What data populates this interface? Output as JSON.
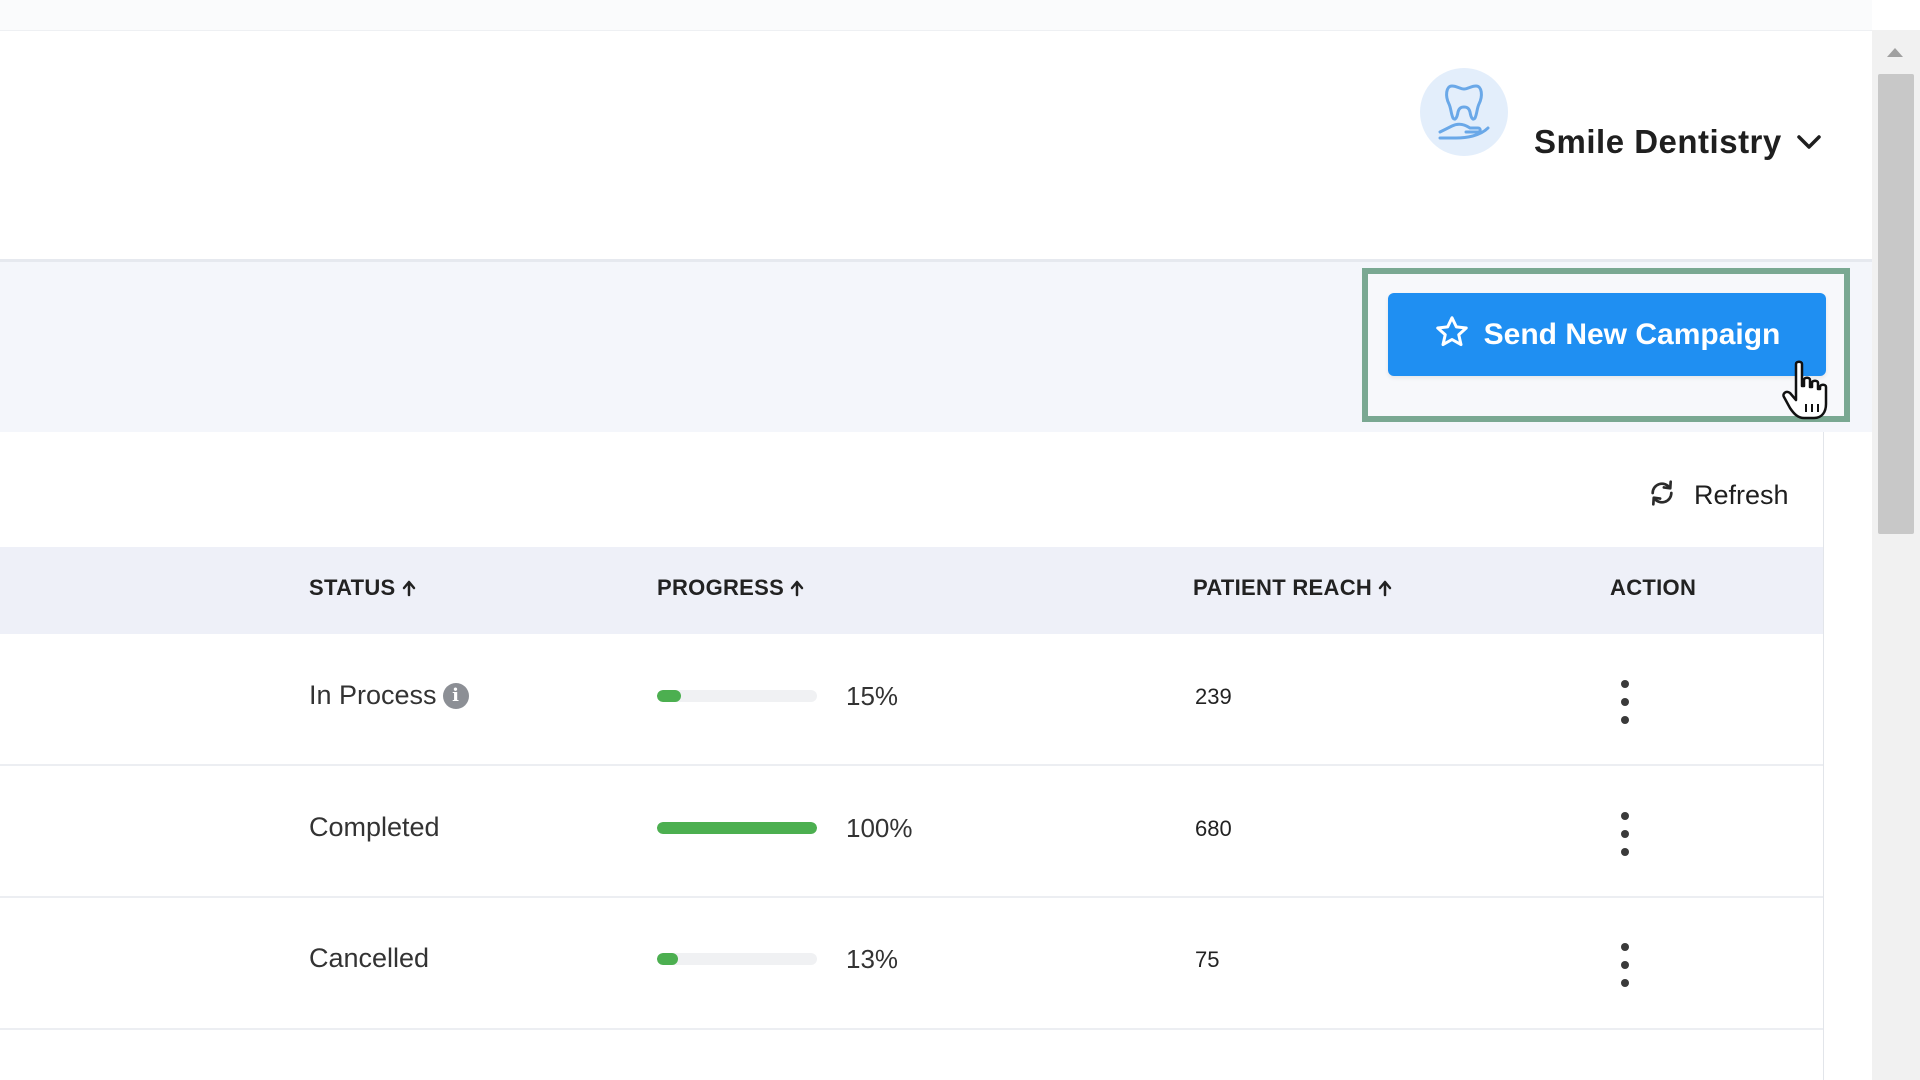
{
  "header": {
    "practice_name": "Smile Dentistry",
    "avatar_icon": "tooth-in-hand-icon",
    "dropdown_icon": "chevron-down-icon"
  },
  "toolbar": {
    "send_campaign_label": "Send New Campaign",
    "send_campaign_icon": "star-icon",
    "refresh_label": "Refresh",
    "refresh_icon": "refresh-icon"
  },
  "table": {
    "columns": [
      {
        "label": "STATUS",
        "sortable": true
      },
      {
        "label": "PROGRESS",
        "sortable": true
      },
      {
        "label": "PATIENT REACH",
        "sortable": true
      },
      {
        "label": "ACTION",
        "sortable": false
      }
    ],
    "rows": [
      {
        "status": "In Process",
        "has_info": true,
        "progress_pct": 15,
        "progress_label": "15%",
        "patient_reach": "239"
      },
      {
        "status": "Completed",
        "has_info": false,
        "progress_pct": 100,
        "progress_label": "100%",
        "patient_reach": "680"
      },
      {
        "status": "Cancelled",
        "has_info": false,
        "progress_pct": 13,
        "progress_label": "13%",
        "patient_reach": "75"
      }
    ]
  },
  "colors": {
    "primary_button": "#1f8ff2",
    "progress_fill": "#4caf50",
    "highlight_border": "#7aa892"
  }
}
